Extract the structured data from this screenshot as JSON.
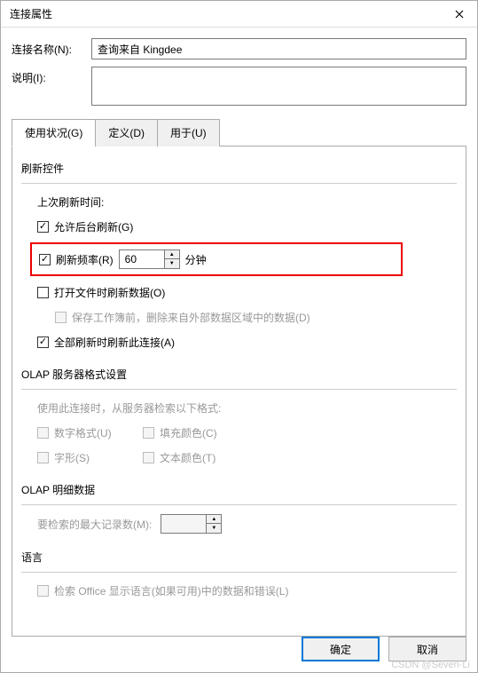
{
  "title": "连接属性",
  "form": {
    "name_label": "连接名称(N):",
    "name_value": "查询来自 Kingdee",
    "desc_label": "说明(I):",
    "desc_value": ""
  },
  "tabs": [
    {
      "label": "使用状况(G)",
      "active": true
    },
    {
      "label": "定义(D)",
      "active": false
    },
    {
      "label": "用于(U)",
      "active": false
    }
  ],
  "refresh": {
    "section_title": "刷新控件",
    "last_refresh_label": "上次刷新时间:",
    "allow_bg_label": "允许后台刷新(G)",
    "allow_bg_checked": true,
    "rate_label": "刷新频率(R)",
    "rate_checked": true,
    "rate_value": "60",
    "rate_unit": "分钟",
    "on_open_label": "打开文件时刷新数据(O)",
    "on_open_checked": false,
    "delete_external_label": "保存工作簿前，删除来自外部数据区域中的数据(D)",
    "delete_external_enabled": false,
    "refresh_all_label": "全部刷新时刷新此连接(A)",
    "refresh_all_checked": true
  },
  "olap_format": {
    "section_title": "OLAP 服务器格式设置",
    "hint": "使用此连接时，从服务器检索以下格式:",
    "number_format_label": "数字格式(U)",
    "fill_color_label": "填充颜色(C)",
    "font_style_label": "字形(S)",
    "text_color_label": "文本颜色(T)"
  },
  "olap_detail": {
    "section_title": "OLAP 明细数据",
    "max_records_label": "要检索的最大记录数(M):",
    "max_records_value": ""
  },
  "lang": {
    "section_title": "语言",
    "search_office_label": "检索 Office 显示语言(如果可用)中的数据和错误(L)"
  },
  "buttons": {
    "ok": "确定",
    "cancel": "取消"
  },
  "watermark": "CSDN @Seven·Li"
}
